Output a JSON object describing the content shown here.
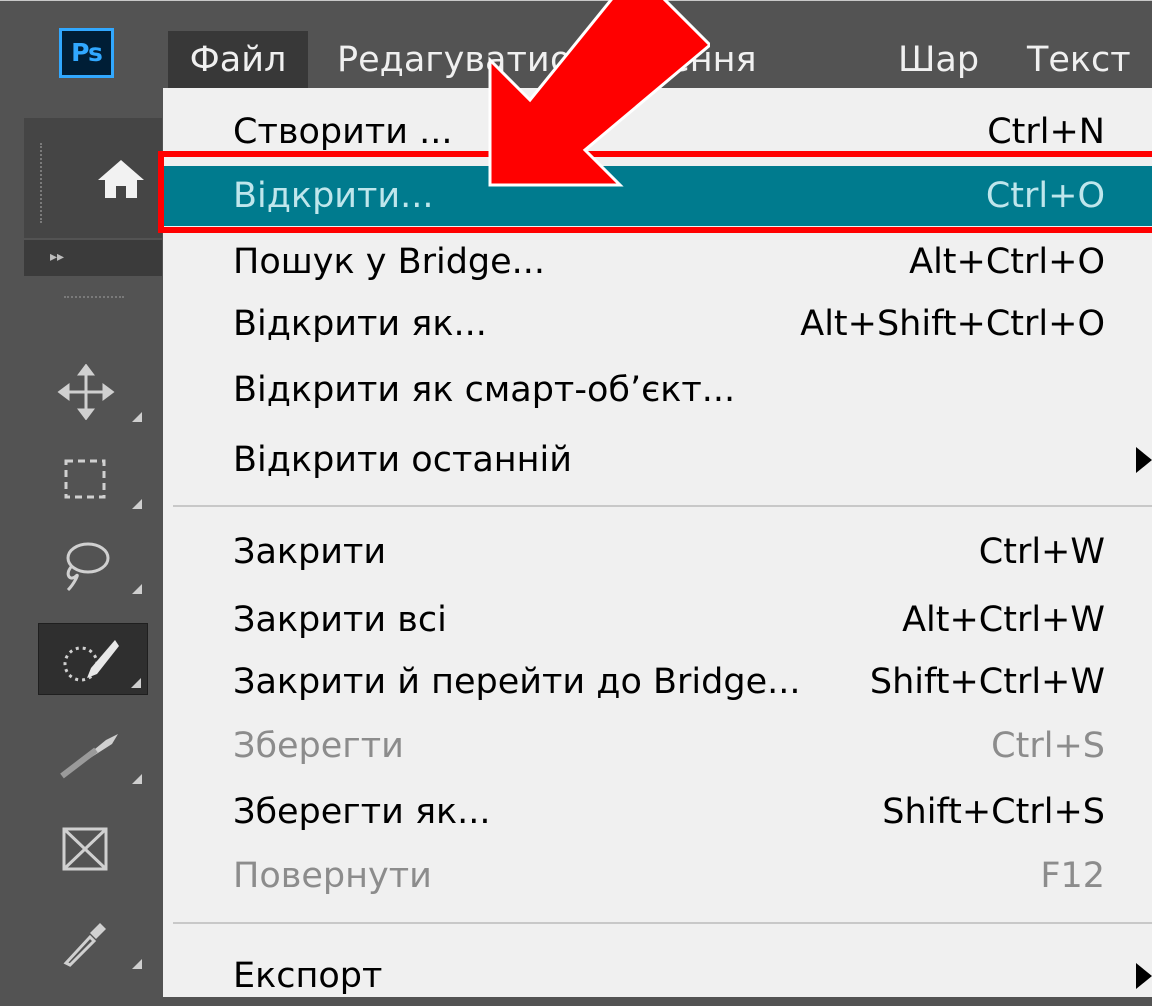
{
  "app": {
    "logo": "Ps"
  },
  "menubar": {
    "items": [
      "Файл",
      "Редагувати",
      "ображення",
      "Шар",
      "Текст"
    ]
  },
  "toolbar": {
    "collapse_label": "▸▸",
    "tools": [
      "home-icon",
      "move-icon",
      "marquee-icon",
      "lasso-icon",
      "quick-selection-icon",
      "crop-icon",
      "frame-icon",
      "eyedropper-icon"
    ]
  },
  "file_menu": {
    "items": [
      {
        "label": "Створити ...",
        "shortcut": "Ctrl+N"
      },
      {
        "label": "Відкрити...",
        "shortcut": "Ctrl+O",
        "selected": true
      },
      {
        "label": "Пошук у Bridge...",
        "shortcut": "Alt+Ctrl+O"
      },
      {
        "label": "Відкрити як...",
        "shortcut": "Alt+Shift+Ctrl+O"
      },
      {
        "label": "Відкрити як смарт-об’єкт...",
        "shortcut": ""
      },
      {
        "label": "Відкрити останній",
        "shortcut": "",
        "submenu": true
      },
      {
        "label": "Закрити",
        "shortcut": "Ctrl+W"
      },
      {
        "label": "Закрити всі",
        "shortcut": "Alt+Ctrl+W"
      },
      {
        "label": "Закрити й перейти до Bridge...",
        "shortcut": "Shift+Ctrl+W"
      },
      {
        "label": "Зберегти",
        "shortcut": "Ctrl+S",
        "disabled": true
      },
      {
        "label": "Зберегти як...",
        "shortcut": "Shift+Ctrl+S"
      },
      {
        "label": "Повернути",
        "shortcut": "F12",
        "disabled": true
      },
      {
        "label": "Експорт",
        "shortcut": "",
        "submenu": true
      }
    ]
  },
  "annotation": {
    "arrow_color": "#ff0000",
    "highlight_color": "#ff0000"
  },
  "colors": {
    "selected_row": "#007b8e",
    "menu_bg": "#f0f0f0",
    "app_bg": "#535353"
  }
}
